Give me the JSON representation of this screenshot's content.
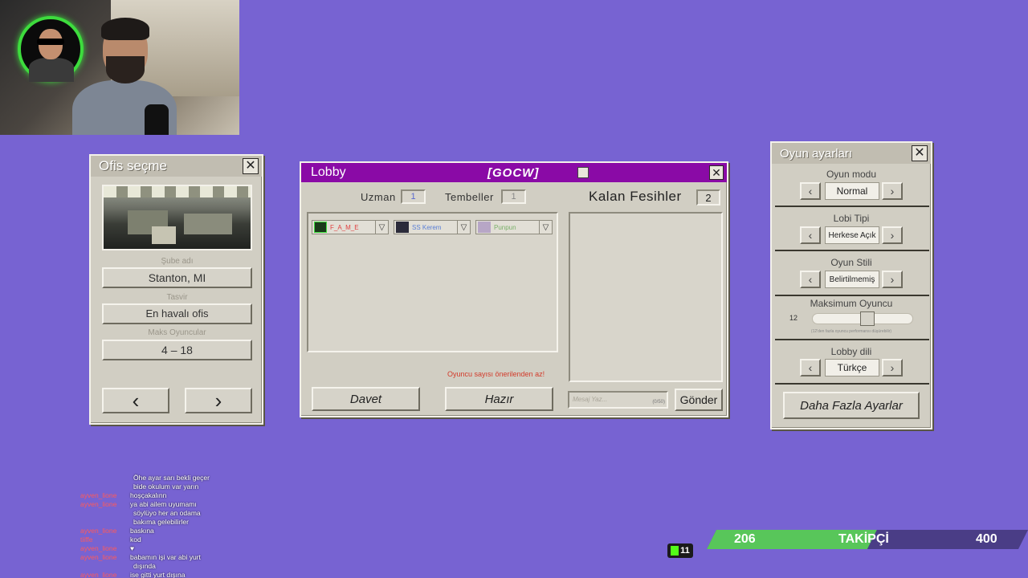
{
  "office": {
    "title": "Ofis seçme",
    "close": "✕",
    "branch_label": "Şube adı",
    "branch_value": "Stanton, MI",
    "desc_label": "Tasvir",
    "desc_value": "En havalı ofis",
    "max_label": "Maks Oyuncular",
    "max_value": "4 – 18",
    "prev": "‹",
    "next": "›"
  },
  "lobby": {
    "title": "Lobby",
    "code": "[GOCW]",
    "close": "✕",
    "expert_label": "Uzman",
    "expert_value": "1",
    "lazy_label": "Tembeller",
    "lazy_value": "1",
    "remaining_label": "Kalan Fesihler",
    "remaining_value": "2",
    "players": [
      {
        "name": "F_A_M_E",
        "color": "#e04040"
      },
      {
        "name": "SS Kerem",
        "color": "#5a7fd6"
      },
      {
        "name": "Punpun",
        "color": "#7ab06a"
      }
    ],
    "warning": "Oyuncu sayısı önerilenden az!",
    "invite": "Davet",
    "ready": "Hazır",
    "message_placeholder": "Mesaj Yaz...",
    "message_count": "(0/50)",
    "send": "Gönder"
  },
  "settings": {
    "title": "Oyun ayarları",
    "close": "✕",
    "mode_label": "Oyun modu",
    "mode_value": "Normal",
    "lobby_type_label": "Lobi Tipi",
    "lobby_type_value": "Herkese Açık",
    "style_label": "Oyun Stili",
    "style_value": "Belirtilmemiş",
    "max_players_label": "Maksimum Oyuncu",
    "max_players_value": "12",
    "max_players_slider": 0.55,
    "max_players_note": "(12'den fazla oyuncu performansı düşürebilir)",
    "lang_label": "Lobby dili",
    "lang_value": "Türkçe",
    "more": "Daha Fazla Ayarlar",
    "left": "‹",
    "right": "›"
  },
  "chat": [
    {
      "user": "",
      "text": "Öhe ayar sarı bekli geçer"
    },
    {
      "user": "",
      "text": "bide okulum var yarın"
    },
    {
      "user": "ayven_lione",
      "text": "hoşçakalınn"
    },
    {
      "user": "ayven_lione",
      "text": "ya abi ailem uyumamı"
    },
    {
      "user": "",
      "text": "söylüyo her an odama"
    },
    {
      "user": "",
      "text": "bakıma gelebilirler"
    },
    {
      "user": "ayven_lione",
      "text": "baskına"
    },
    {
      "user": "tiiffe",
      "text": "kod"
    },
    {
      "user": "ayven_lione",
      "text": "♥"
    },
    {
      "user": "ayven_lione",
      "text": "babamın işi var abi yurt"
    },
    {
      "user": "",
      "text": "dışında"
    },
    {
      "user": "ayven_lione",
      "text": "ise gitti yurt dışına"
    }
  ],
  "followers": {
    "current": "206",
    "label": "TAKİPÇİ",
    "goal": "400",
    "progress": 0.515
  },
  "badge": "11"
}
